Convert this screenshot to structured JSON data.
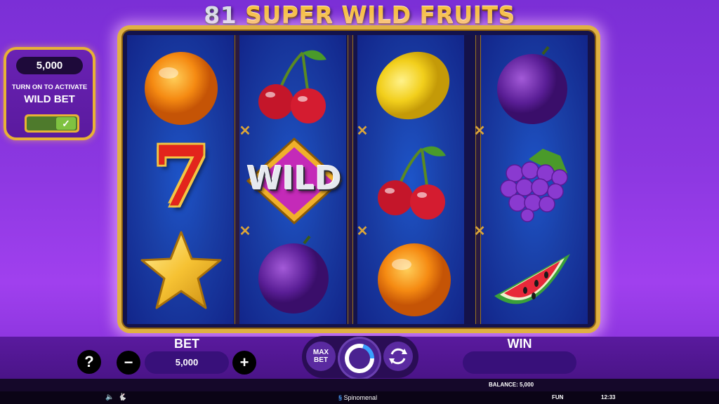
{
  "game": {
    "title_number": "81",
    "title_text": "SUPER WILD FRUITS"
  },
  "wild_panel": {
    "amount": "5,000",
    "subtitle": "TURN ON TO ACTIVATE",
    "title": "WILD BET",
    "toggle_on": true,
    "check": "✓"
  },
  "reels": [
    [
      "orange",
      "seven",
      "star"
    ],
    [
      "cherry",
      "wild",
      "plum"
    ],
    [
      "lemon",
      "cherry",
      "orange"
    ],
    [
      "plum",
      "grapes",
      "watermelon"
    ]
  ],
  "wild_symbol_text": "WILD",
  "seven_text": "7",
  "controls": {
    "bet_label": "BET",
    "bet_value": "5,000",
    "win_label": "WIN",
    "win_value": "",
    "help": "?",
    "minus": "−",
    "plus": "+",
    "max_bet_line1": "MAX",
    "max_bet_line2": "BET"
  },
  "status": {
    "balance": "BALANCE: 5,000"
  },
  "footer": {
    "brand": "Spinomenal",
    "mode": "FUN",
    "time": "12:33"
  }
}
